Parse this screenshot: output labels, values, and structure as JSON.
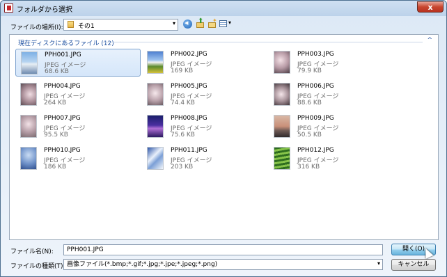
{
  "window": {
    "title": "フォルダから選択",
    "close_glyph": "x"
  },
  "location": {
    "label": "ファイルの場所(I):",
    "value": "その1",
    "arrow": "▾"
  },
  "group": {
    "header": "現在ディスクにあるファイル (12)",
    "collapse_glyph": "^"
  },
  "files": [
    {
      "name": "PPH001.JPG",
      "type": "JPEG イメージ",
      "size": "68.6 KB",
      "selected": true,
      "thumb": "sky-mountain"
    },
    {
      "name": "PPH002.JPG",
      "type": "JPEG イメージ",
      "size": "169 KB",
      "thumb": "mount-fuji-field"
    },
    {
      "name": "PPH003.JPG",
      "type": "JPEG イメージ",
      "size": "79.9 KB",
      "thumb": "cherry-blossom"
    },
    {
      "name": "PPH004.JPG",
      "type": "JPEG イメージ",
      "size": "264 KB",
      "thumb": "cherry-blossom"
    },
    {
      "name": "PPH005.JPG",
      "type": "JPEG イメージ",
      "size": "74.4 KB",
      "thumb": "cherry-blossom"
    },
    {
      "name": "PPH006.JPG",
      "type": "JPEG イメージ",
      "size": "88.6 KB",
      "thumb": "cherry-blossom"
    },
    {
      "name": "PPH007.JPG",
      "type": "JPEG イメージ",
      "size": "95.5 KB",
      "thumb": "cherry-blossom"
    },
    {
      "name": "PPH008.JPG",
      "type": "JPEG イメージ",
      "size": "75.6 KB",
      "thumb": "purple-mountain"
    },
    {
      "name": "PPH009.JPG",
      "type": "JPEG イメージ",
      "size": "50.5 KB",
      "thumb": "sunset"
    },
    {
      "name": "PPH010.JPG",
      "type": "JPEG イメージ",
      "size": "186 KB",
      "thumb": "blue-blossom"
    },
    {
      "name": "PPH011.JPG",
      "type": "JPEG イメージ",
      "size": "203 KB",
      "thumb": "snowy-mountain"
    },
    {
      "name": "PPH012.JPG",
      "type": "JPEG イメージ",
      "size": "316 KB",
      "thumb": "green-terrace"
    }
  ],
  "filename": {
    "label": "ファイル名(N):",
    "value": "PPH001.JPG"
  },
  "filetype": {
    "label": "ファイルの種類(T):",
    "value": "画像ファイル(*.bmp;*.gif;*.jpg;*.jpe;*.jpeg;*.png)",
    "arrow": "▾"
  },
  "buttons": {
    "open": "開く(O)",
    "cancel": "キャンセル"
  },
  "colors": {
    "title_bar": "#cfe0f2",
    "selection": "#d5e6fa",
    "group_header": "#1e50a0"
  }
}
